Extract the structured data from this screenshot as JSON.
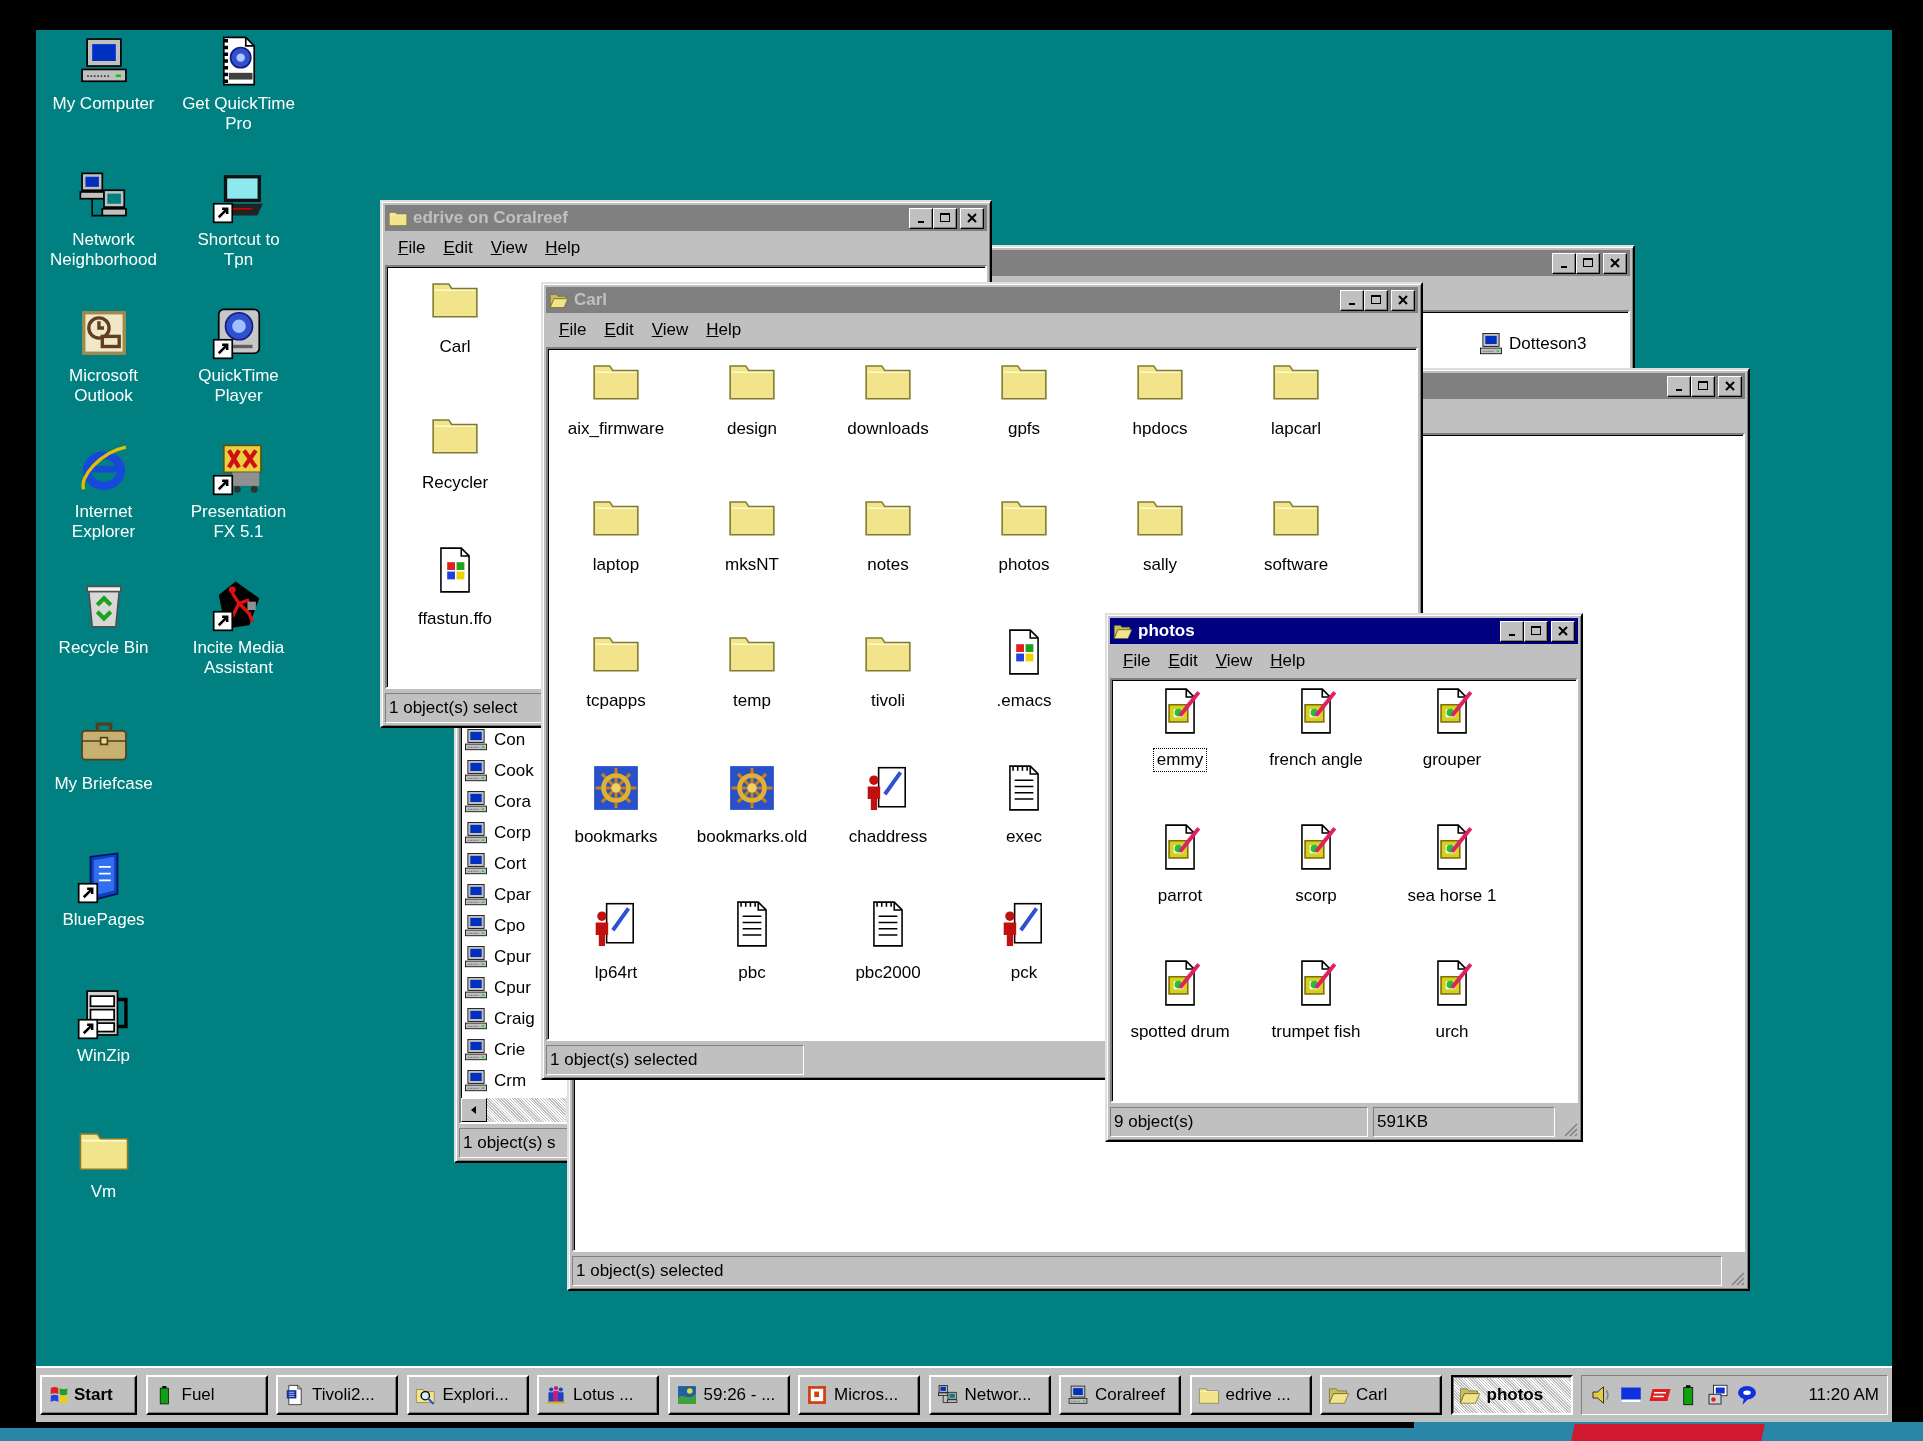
{
  "desktop_icons": [
    {
      "label": "My Computer",
      "kind": "computer",
      "shortcut": false
    },
    {
      "label": "Get QuickTime Pro",
      "kind": "movie",
      "shortcut": false
    },
    {
      "label": "Network Neighborhood",
      "kind": "network",
      "shortcut": false
    },
    {
      "label": "Shortcut to Tpn",
      "kind": "laptop",
      "shortcut": true
    },
    {
      "label": "Microsoft Outlook",
      "kind": "outlook",
      "shortcut": false
    },
    {
      "label": "QuickTime Player",
      "kind": "quicktime",
      "shortcut": true
    },
    {
      "label": "Internet Explorer",
      "kind": "ie",
      "shortcut": false
    },
    {
      "label": "Presentation FX 5.1",
      "kind": "fx",
      "shortcut": true
    },
    {
      "label": "Recycle Bin",
      "kind": "recycle",
      "shortcut": false
    },
    {
      "label": "Incite Media Assistant",
      "kind": "incite",
      "shortcut": true
    },
    {
      "label": "My Briefcase",
      "kind": "briefcase",
      "shortcut": false
    },
    {
      "label": "BluePages",
      "kind": "bluepages",
      "shortcut": true
    },
    {
      "label": "WinZip",
      "kind": "winzip",
      "shortcut": true
    },
    {
      "label": "Vm",
      "kind": "folder",
      "shortcut": false
    }
  ],
  "windows": [
    {
      "kind": "list",
      "active": false,
      "columns": [
        {
          "items": [
            {
              "label": "Con"
            },
            {
              "label": "Cook"
            },
            {
              "label": "Cora"
            },
            {
              "label": "Corp"
            },
            {
              "label": "Cort"
            },
            {
              "label": "Cpar"
            },
            {
              "label": "Cpo"
            },
            {
              "label": "Cpur"
            },
            {
              "label": "Cpur"
            },
            {
              "label": "Craig"
            },
            {
              "label": "Crie"
            },
            {
              "label": "Crm"
            }
          ]
        },
        {
          "items": [
            {
              "label": "Dotteson3"
            }
          ]
        }
      ],
      "status": [
        "1 object(s) s"
      ]
    },
    {
      "kind": "blank",
      "active": false,
      "status": [
        "1 object(s) selected"
      ]
    },
    {
      "kind": "icons",
      "title": "edrive on Coralreef",
      "open": false,
      "active": false,
      "menu": [
        "File",
        "Edit",
        "View",
        "Help"
      ],
      "icon_rows": [
        [
          {
            "label": "Carl",
            "kind": "folder"
          }
        ],
        [
          {
            "label": "Recycler",
            "kind": "folder"
          }
        ],
        [
          {
            "label": "ffastun.ffo",
            "kind": "winfile"
          }
        ]
      ],
      "status": [
        "1 object(s) select"
      ]
    },
    {
      "kind": "icons",
      "title": "Carl",
      "open": true,
      "active": false,
      "menu": [
        "File",
        "Edit",
        "View",
        "Help"
      ],
      "icon_rows": [
        [
          {
            "label": "aix_firmware",
            "kind": "folder"
          },
          {
            "label": "design",
            "kind": "folder"
          },
          {
            "label": "downloads",
            "kind": "folder"
          },
          {
            "label": "gpfs",
            "kind": "folder"
          },
          {
            "label": "hpdocs",
            "kind": "folder"
          },
          {
            "label": "lapcarl",
            "kind": "folder"
          }
        ],
        [
          {
            "label": "laptop",
            "kind": "folder"
          },
          {
            "label": "mksNT",
            "kind": "folder"
          },
          {
            "label": "notes",
            "kind": "folder"
          },
          {
            "label": "photos",
            "kind": "folder"
          },
          {
            "label": "sally",
            "kind": "folder"
          },
          {
            "label": "software",
            "kind": "folder"
          }
        ],
        [
          {
            "label": "tcpapps",
            "kind": "folder"
          },
          {
            "label": "temp",
            "kind": "folder"
          },
          {
            "label": "tivoli",
            "kind": "folder"
          },
          {
            "label": ".emacs",
            "kind": "winfile"
          }
        ],
        [
          {
            "label": "bookmarks",
            "kind": "helm"
          },
          {
            "label": "bookmarks.old",
            "kind": "helm"
          },
          {
            "label": "chaddress",
            "kind": "person"
          },
          {
            "label": "exec",
            "kind": "notepad"
          }
        ],
        [
          {
            "label": "lp64rt",
            "kind": "person"
          },
          {
            "label": "pbc",
            "kind": "notepad"
          },
          {
            "label": "pbc2000",
            "kind": "notepad"
          },
          {
            "label": "pck",
            "kind": "person"
          }
        ]
      ],
      "status": [
        "1 object(s) selected"
      ]
    },
    {
      "kind": "icons",
      "title": "photos",
      "open": true,
      "active": true,
      "menu": [
        "File",
        "Edit",
        "View",
        "Help"
      ],
      "icon_rows": [
        [
          {
            "label": "emmy",
            "kind": "image",
            "focused": true
          },
          {
            "label": "french angle",
            "kind": "image",
            "focused": false
          },
          {
            "label": "grouper",
            "kind": "image",
            "focused": false
          }
        ],
        [
          {
            "label": "parrot",
            "kind": "image",
            "focused": false
          },
          {
            "label": "scorp",
            "kind": "image",
            "focused": false
          },
          {
            "label": "sea horse 1",
            "kind": "image",
            "focused": false
          }
        ],
        [
          {
            "label": "spotted drum",
            "kind": "image",
            "focused": false
          },
          {
            "label": "trumpet fish",
            "kind": "image",
            "focused": false
          },
          {
            "label": "urch",
            "kind": "image",
            "focused": false
          }
        ]
      ],
      "status": [
        "9 object(s)",
        "591KB"
      ]
    }
  ],
  "taskbar": {
    "start": "Start",
    "buttons": [
      {
        "label": "Fuel",
        "kind": "battery",
        "selected": false
      },
      {
        "label": "Tivoli2...",
        "kind": "word",
        "selected": false
      },
      {
        "label": "Explori...",
        "kind": "explorer",
        "selected": false
      },
      {
        "label": "Lotus ...",
        "kind": "lotus",
        "selected": false
      },
      {
        "label": "59:26 - ...",
        "kind": "globe",
        "selected": false
      },
      {
        "label": "Micros...",
        "kind": "ppt",
        "selected": false
      },
      {
        "label": "Networ...",
        "kind": "network",
        "selected": false
      },
      {
        "label": "Coralreef",
        "kind": "computer",
        "selected": false
      },
      {
        "label": "edrive ...",
        "kind": "folder",
        "selected": false
      },
      {
        "label": "Carl",
        "kind": "open_folder",
        "selected": false
      },
      {
        "label": "photos",
        "kind": "open_folder",
        "selected": true
      }
    ],
    "clock": "11:20 AM"
  }
}
